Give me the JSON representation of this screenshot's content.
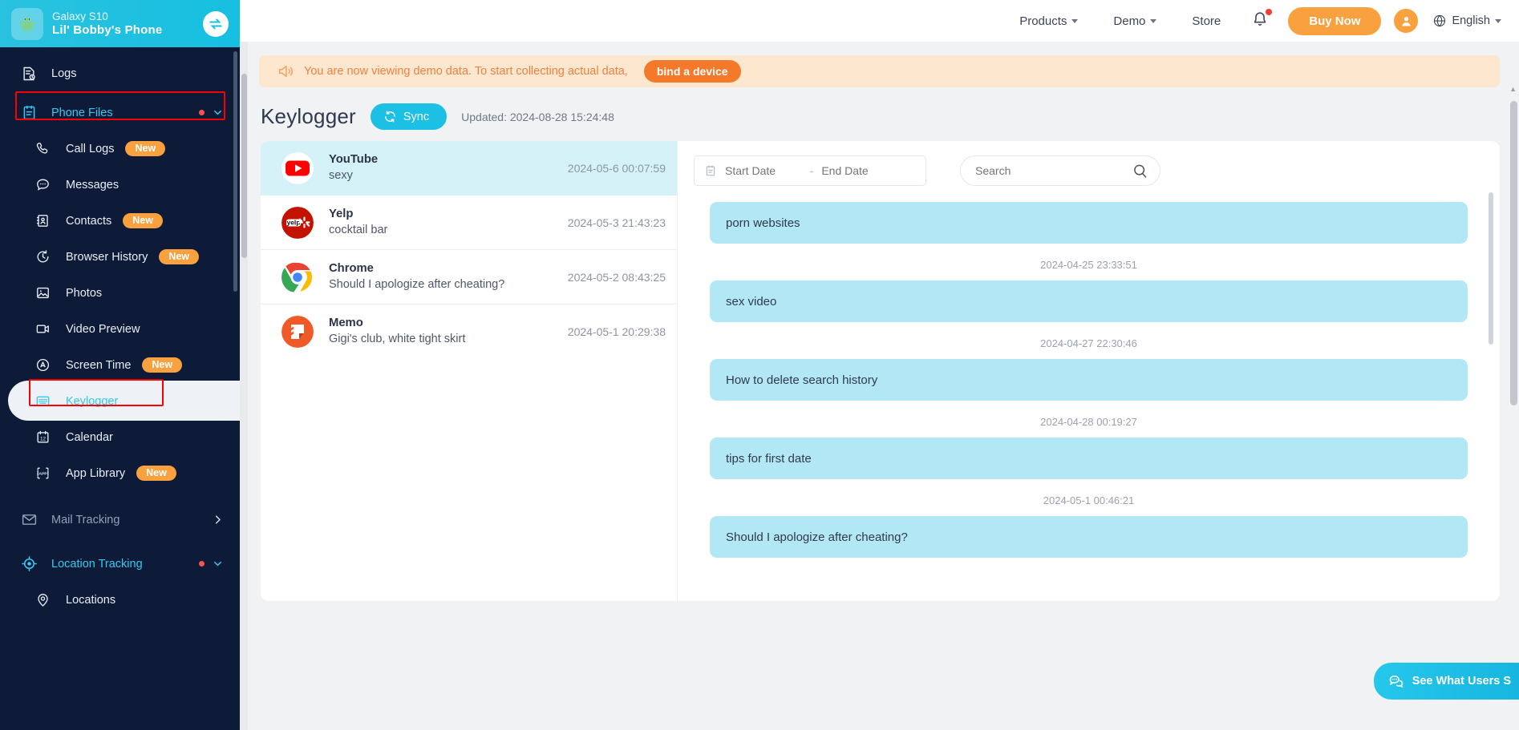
{
  "device": {
    "model": "Galaxy S10",
    "name": "Lil' Bobby's Phone",
    "avatar_icon": "android-robot-icon",
    "switch_icon": "switch-device-icon"
  },
  "sidebar": {
    "items": [
      {
        "label": "Logs",
        "icon": "logs-icon",
        "type": "top",
        "badge": "",
        "active": false
      },
      {
        "label": "Phone Files",
        "icon": "phone-files-icon",
        "type": "group",
        "badge": "",
        "active": false,
        "dot": true,
        "chevron": "down",
        "highlight": true
      },
      {
        "label": "Call Logs",
        "icon": "phone-icon",
        "type": "sub",
        "badge": "New"
      },
      {
        "label": "Messages",
        "icon": "message-bubble-icon",
        "type": "sub",
        "badge": ""
      },
      {
        "label": "Contacts",
        "icon": "contacts-icon",
        "type": "sub",
        "badge": "New"
      },
      {
        "label": "Browser History",
        "icon": "history-clock-icon",
        "type": "sub",
        "badge": "New"
      },
      {
        "label": "Photos",
        "icon": "photo-icon",
        "type": "sub",
        "badge": ""
      },
      {
        "label": "Video Preview",
        "icon": "video-camera-icon",
        "type": "sub",
        "badge": ""
      },
      {
        "label": "Screen Time",
        "icon": "screen-time-icon",
        "type": "sub",
        "badge": "New"
      },
      {
        "label": "Keylogger",
        "icon": "keyboard-icon",
        "type": "sub",
        "badge": "",
        "active": true,
        "highlight": true
      },
      {
        "label": "Calendar",
        "icon": "calendar-icon",
        "type": "sub",
        "badge": ""
      },
      {
        "label": "App Library",
        "icon": "app-library-icon",
        "type": "sub",
        "badge": "New"
      },
      {
        "label": "Mail Tracking",
        "icon": "mail-icon",
        "type": "group",
        "badge": "",
        "muted": true,
        "chevron": "right"
      },
      {
        "label": "Location Tracking",
        "icon": "location-target-icon",
        "type": "group",
        "badge": "",
        "dot": true,
        "chevron": "down"
      },
      {
        "label": "Locations",
        "icon": "map-pin-icon",
        "type": "sub",
        "badge": ""
      }
    ]
  },
  "topnav": {
    "items": [
      {
        "label": "Products",
        "caret": true
      },
      {
        "label": "Demo",
        "caret": true
      },
      {
        "label": "Store",
        "caret": false
      }
    ],
    "bell_icon": "notification-bell-icon",
    "buy_now": "Buy Now",
    "avatar_icon": "user-avatar-icon",
    "language": "English",
    "globe_icon": "globe-icon"
  },
  "notice": {
    "icon": "megaphone-icon",
    "text": "You are now viewing demo data. To start collecting actual data,",
    "button": "bind a device"
  },
  "page": {
    "title": "Keylogger",
    "sync_label": "Sync",
    "sync_icon": "refresh-icon",
    "updated": "Updated: 2024-08-28 15:24:48"
  },
  "apps": [
    {
      "name": "YouTube",
      "preview": "sexy",
      "time": "2024-05-6 00:07:59",
      "icon": "youtube-icon",
      "selected": true
    },
    {
      "name": "Yelp",
      "preview": "cocktail bar",
      "time": "2024-05-3 21:43:23",
      "icon": "yelp-icon",
      "selected": false
    },
    {
      "name": "Chrome",
      "preview": "Should I apologize after cheating?",
      "time": "2024-05-2 08:43:25",
      "icon": "chrome-icon",
      "selected": false
    },
    {
      "name": "Memo",
      "preview": "Gigi's club, white tight skirt",
      "time": "2024-05-1 20:29:38",
      "icon": "memo-icon",
      "selected": false
    }
  ],
  "filters": {
    "calendar_icon": "calendar-small-icon",
    "start_date_placeholder": "Start Date",
    "dash": "-",
    "end_date_placeholder": "End Date",
    "search_placeholder": "Search",
    "search_value": "",
    "search_icon": "search-icon"
  },
  "messages": [
    {
      "text": "porn websites",
      "time": "2024-04-25 23:33:51"
    },
    {
      "text": "sex video",
      "time": "2024-04-27 22:30:46"
    },
    {
      "text": "How to delete search history",
      "time": "2024-04-28 00:19:27"
    },
    {
      "text": "tips for first date",
      "time": "2024-05-1 00:46:21"
    },
    {
      "text": "Should I apologize after cheating?",
      "time": ""
    }
  ],
  "chat_widget": {
    "label": "See What Users S",
    "icon": "chat-bubbles-icon"
  },
  "colors": {
    "sidebar_bg": "#0d1b38",
    "header_cyan": "#22c1e0",
    "accent_orange": "#f9a03f",
    "bubble_blue": "#b2e8f5",
    "selected_row": "#d4f2f8",
    "highlight_red": "#fb0000"
  }
}
